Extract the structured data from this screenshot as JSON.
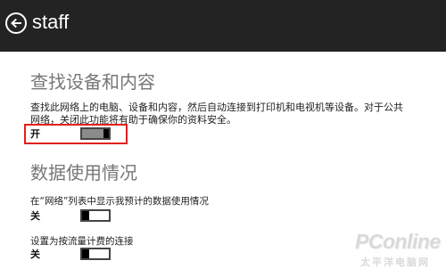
{
  "header": {
    "title": "staff",
    "back_icon": "back-arrow-icon"
  },
  "section_find": {
    "title": "查找设备和内容",
    "description": "查找此网络上的电脑、设备和内容，然后自动连接到打印机和电视机等设备。对于公共网络，关闭此功能将有助于确保你的资料安全。",
    "state_label": "开",
    "toggle_on": true,
    "highlight_color": "#e32020"
  },
  "section_data": {
    "title": "数据使用情况",
    "rows": [
      {
        "label": "在“网络”列表中显示我预计的数据使用情况",
        "state_label": "关",
        "toggle_on": false
      },
      {
        "label": "设置为按流量计费的连接",
        "state_label": "关",
        "toggle_on": false
      }
    ]
  },
  "watermark": {
    "main": "PConline",
    "sub": "太平洋电脑网"
  },
  "colors": {
    "header_bg": "#232323",
    "section_title": "#777777",
    "toggle_fill": "#8b8b8b"
  }
}
